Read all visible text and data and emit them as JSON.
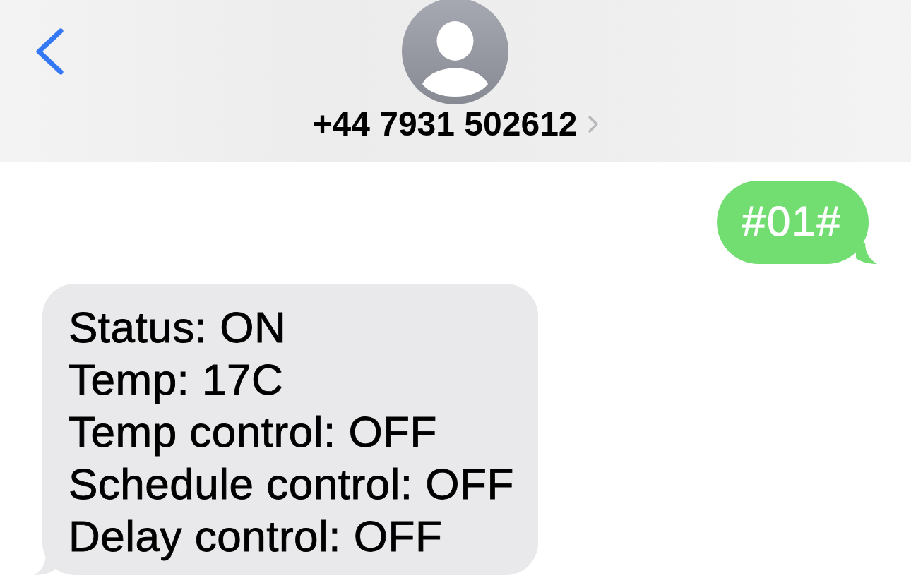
{
  "header": {
    "contact": {
      "phone": "+44 7931 502612"
    }
  },
  "messages": [
    {
      "kind": "sent",
      "lines": [
        "#01#"
      ]
    },
    {
      "kind": "received",
      "lines": [
        "Status: ON",
        "Temp: 17C",
        "Temp control: OFF",
        "Schedule control: OFF",
        "Delay control: OFF"
      ]
    }
  ]
}
